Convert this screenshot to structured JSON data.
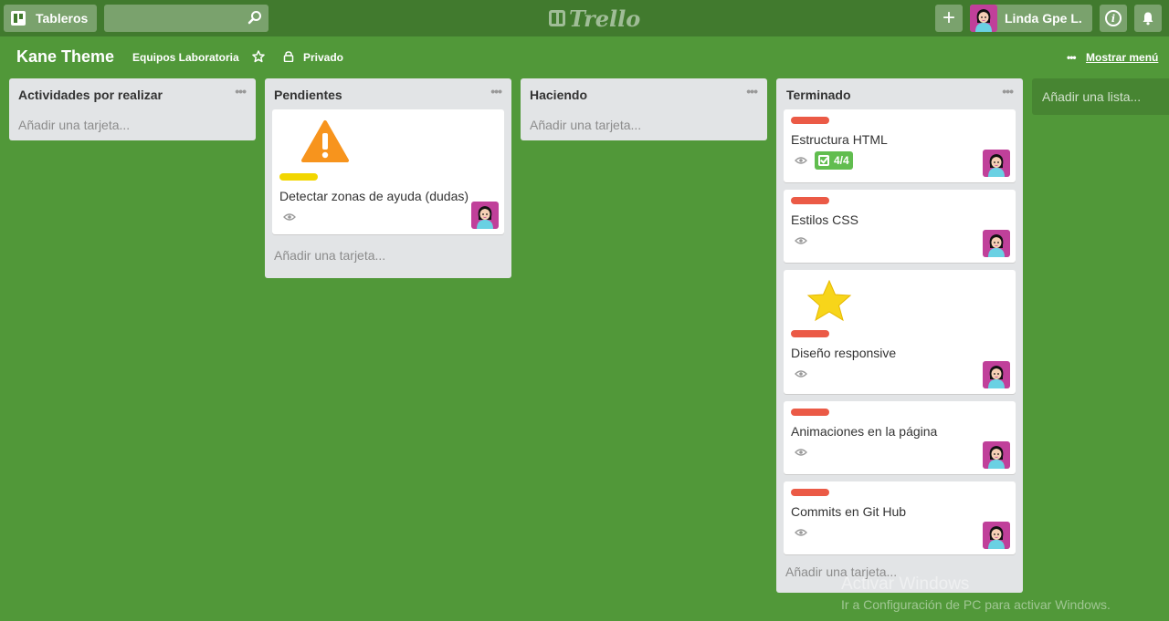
{
  "header": {
    "boards_label": "Tableros",
    "search_placeholder": "",
    "logo_text": "Trello",
    "user_name": "Linda Gpe L."
  },
  "board": {
    "title": "Kane Theme",
    "team": "Equipos Laboratoria",
    "visibility": "Privado",
    "show_menu": "Mostrar menú",
    "add_list": "Añadir una lista..."
  },
  "lists": [
    {
      "title": "Actividades por realizar",
      "add_card": "Añadir una tarjeta..."
    },
    {
      "title": "Pendientes",
      "add_card": "Añadir una tarjeta..."
    },
    {
      "title": "Haciendo",
      "add_card": "Añadir una tarjeta..."
    },
    {
      "title": "Terminado",
      "add_card": "Añadir una tarjeta..."
    }
  ],
  "cards": {
    "pendientes_0": {
      "title": "Detectar zonas de ayuda (dudas)",
      "label_color": "#f2d600",
      "sticker": "warning-icon"
    },
    "terminado_0": {
      "title": "Estructura HTML",
      "label_color": "#eb5a46",
      "checklist": "4/4"
    },
    "terminado_1": {
      "title": "Estilos CSS",
      "label_color": "#eb5a46"
    },
    "terminado_2": {
      "title": "Diseño responsive",
      "label_color": "#eb5a46",
      "sticker": "star-icon"
    },
    "terminado_3": {
      "title": "Animaciones en la página",
      "label_color": "#eb5a46"
    },
    "terminado_4": {
      "title": "Commits en Git Hub",
      "label_color": "#eb5a46"
    }
  },
  "watermark": {
    "line1": "Activar Windows",
    "line2": "Ir a Configuración de PC para activar Windows."
  },
  "colors": {
    "board_bg": "#519839",
    "header_bg": "#417a2e",
    "list_bg": "#e2e4e6",
    "badge_green": "#61bd4f"
  }
}
